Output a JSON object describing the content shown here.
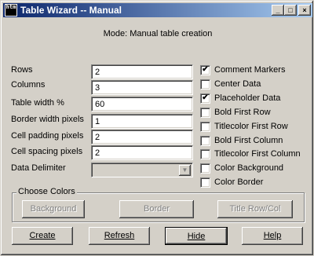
{
  "window": {
    "title": "Table Wizard -- Manual",
    "icon": "htm",
    "controls": {
      "minimize": "_",
      "maximize": "□",
      "close": "×"
    }
  },
  "mode_text": "Mode: Manual table creation",
  "fields": [
    {
      "label": "Rows",
      "value": "2"
    },
    {
      "label": "Columns",
      "value": "3"
    },
    {
      "label": "Table width %",
      "value": "60"
    },
    {
      "label": "Border width pixels",
      "value": "1"
    },
    {
      "label": "Cell padding pixels",
      "value": "2"
    },
    {
      "label": "Cell spacing pixels",
      "value": "2"
    }
  ],
  "delimiter": {
    "label": "Data Delimiter",
    "value": "",
    "arrow": "▼"
  },
  "checkboxes": [
    {
      "label": "Comment Markers",
      "checked": "✔"
    },
    {
      "label": "Center Data",
      "checked": ""
    },
    {
      "label": "Placeholder Data",
      "checked": "✔"
    },
    {
      "label": "Bold First Row",
      "checked": ""
    },
    {
      "label": "Titlecolor First Row",
      "checked": ""
    },
    {
      "label": "Bold First Column",
      "checked": ""
    },
    {
      "label": "Titlecolor First Column",
      "checked": ""
    },
    {
      "label": "Color Background",
      "checked": ""
    },
    {
      "label": "Color Border",
      "checked": ""
    }
  ],
  "colors_group": {
    "title": "Choose Colors",
    "buttons": [
      "Background",
      "Border",
      "Title Row/Col"
    ]
  },
  "actions": [
    "Create",
    "Refresh",
    "Hide",
    "Help"
  ]
}
